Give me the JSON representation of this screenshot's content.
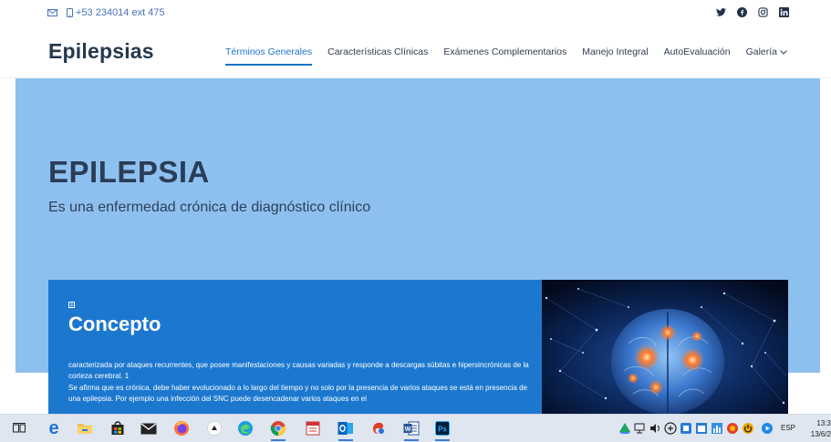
{
  "topbar": {
    "phone": "+53 234014 ext 475",
    "icons": [
      "mail-icon",
      "phone-icon"
    ],
    "social": [
      "twitter-icon",
      "facebook-icon",
      "instagram-icon",
      "linkedin-icon"
    ]
  },
  "header": {
    "brand": "Epilepsias",
    "nav": [
      {
        "label": "Términos Generales",
        "active": true
      },
      {
        "label": "Características Clínicas"
      },
      {
        "label": "Exámenes Complementarios"
      },
      {
        "label": "Manejo Integral"
      },
      {
        "label": "AutoEvaluación"
      },
      {
        "label": "Galería",
        "dropdown": true
      }
    ]
  },
  "hero": {
    "title": "EPILEPSIA",
    "subtitle": "Es una enfermedad crónica de diagnóstico clínico"
  },
  "concept": {
    "title": "Concepto",
    "paragraphs": [
      "caracterizada por ataques recurrentes, que posee manifestaciones y causas variadas y responde a descargas súbitas e hipersincrónicas de la corteza cerebral. 1",
      "Se afirma que es crónica, debe haber evolucionado a lo largo del tiempo y no solo por la presencia de varios ataques se está en presencia de una epilepsia. Por ejemplo una infección del SNC puede desencadenar varios ataques en el"
    ]
  },
  "taskbar": {
    "apps": [
      "task-view-icon",
      "edge-legacy-icon",
      "file-explorer-icon",
      "store-icon",
      "mail-app-icon",
      "firefox-icon",
      "app-icon",
      "edge-icon",
      "chrome-icon",
      "calendar-app-icon",
      "outlook-icon",
      "spotify-like-icon",
      "word-icon",
      "photoshop-icon"
    ],
    "lang": "ESP",
    "time": "13:3",
    "date": "13/6/2"
  },
  "colors": {
    "accent": "#1a73c8",
    "hero_bg": "#8ec0ef",
    "card_bg": "#1c78cf",
    "brand": "#25384f"
  }
}
